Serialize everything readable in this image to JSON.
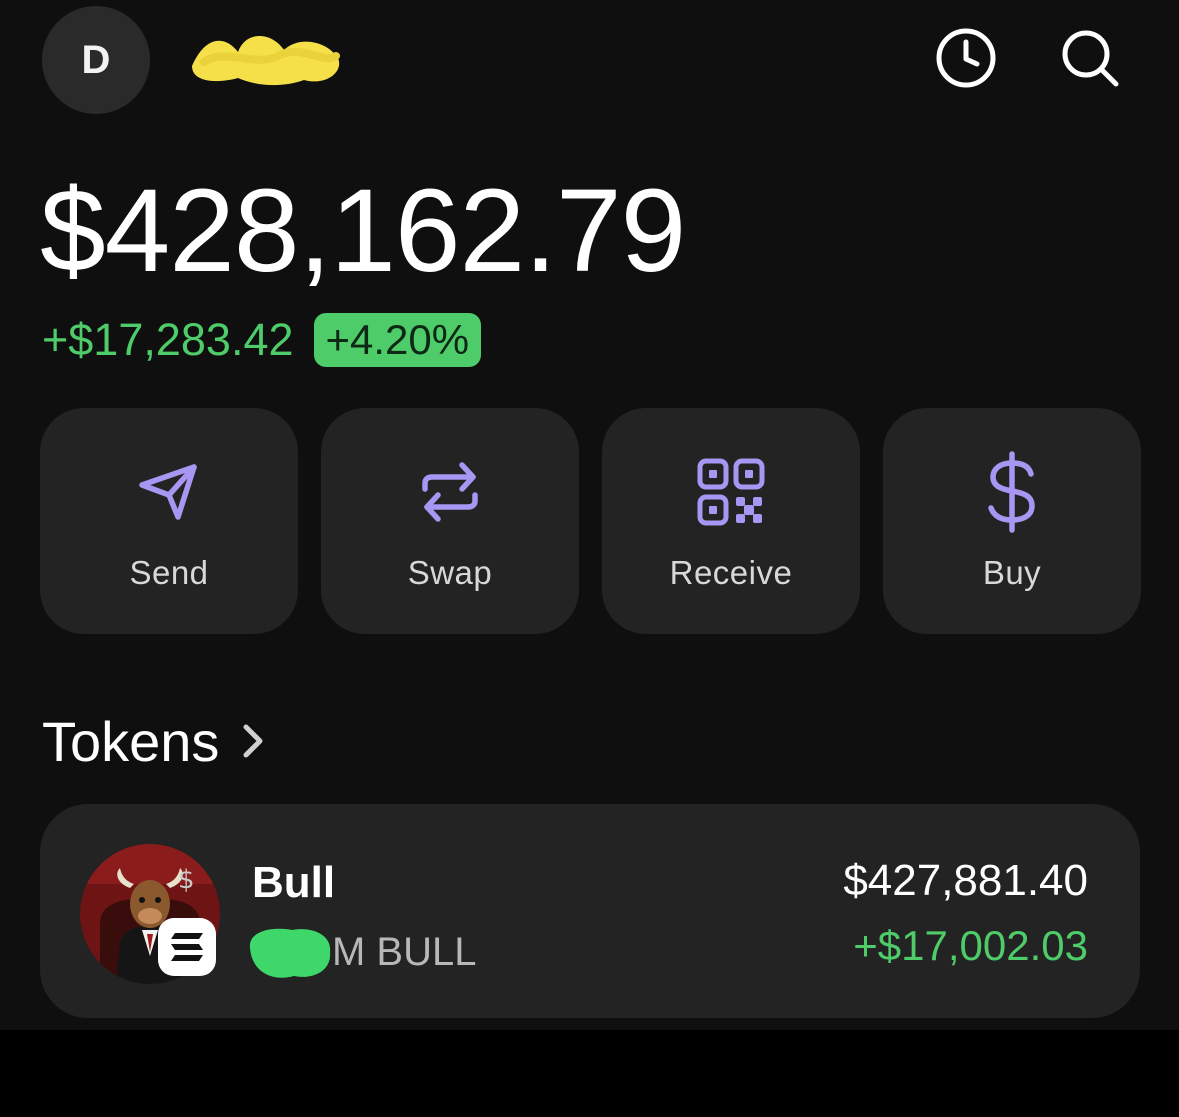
{
  "header": {
    "avatar_initial": "D",
    "account_name": "",
    "history_icon": "clock-icon",
    "search_icon": "search-icon"
  },
  "portfolio": {
    "balance": "$428,162.79",
    "change_amount": "+$17,283.42",
    "change_percent": "+4.20%"
  },
  "actions": [
    {
      "label": "Send",
      "icon": "send-icon"
    },
    {
      "label": "Swap",
      "icon": "swap-icon"
    },
    {
      "label": "Receive",
      "icon": "qr-code-icon"
    },
    {
      "label": "Buy",
      "icon": "dollar-icon"
    }
  ],
  "tokens": {
    "section_title": "Tokens",
    "items": [
      {
        "name": "Bull",
        "subtitle": "M BULL",
        "value": "$427,881.40",
        "change": "+$17,002.03",
        "chain_icon": "solana-icon"
      }
    ]
  },
  "colors": {
    "background": "#0f0f0f",
    "card": "#232323",
    "positive": "#4fcc6a",
    "accent": "#a897f2",
    "redaction_yellow": "#f5e04a",
    "redaction_green": "#3ed86a"
  }
}
